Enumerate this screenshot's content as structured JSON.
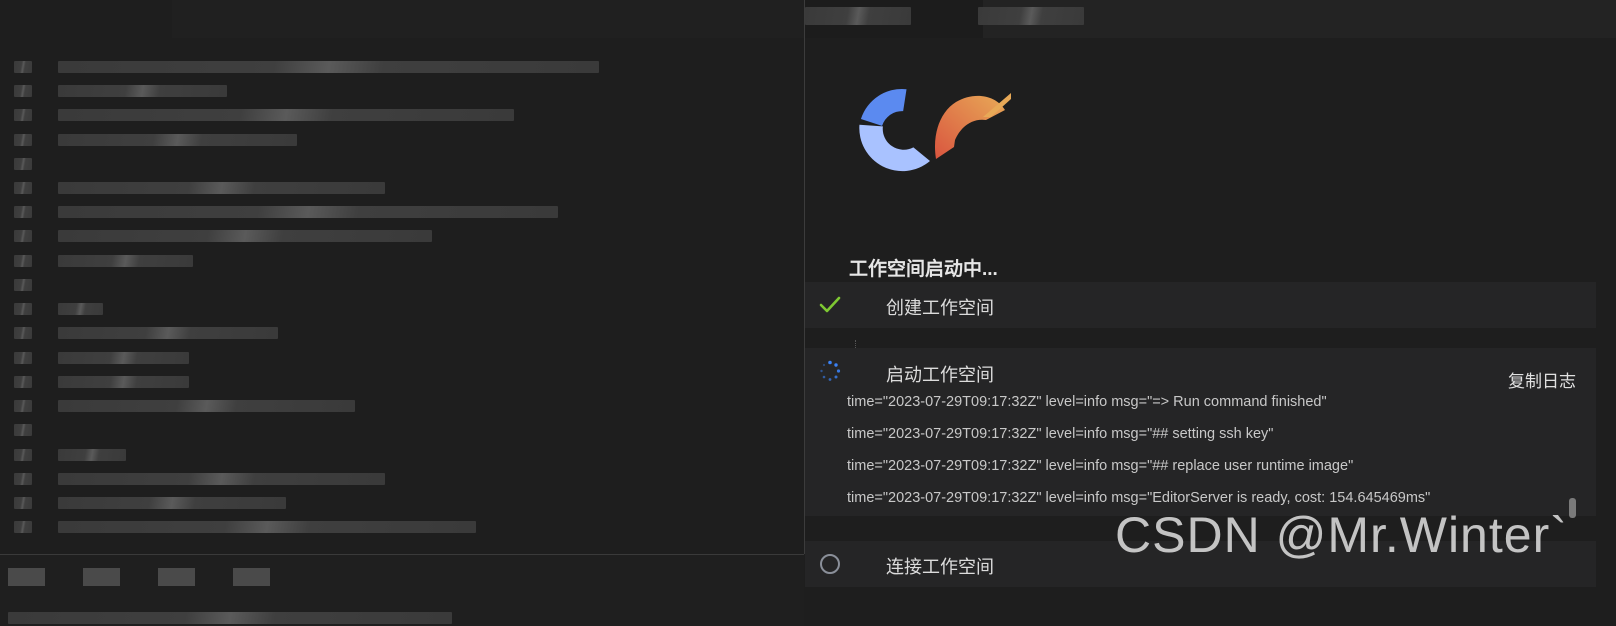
{
  "workspace": {
    "title": "工作空间启动中...",
    "steps": [
      {
        "label": "创建工作空间",
        "status": "done"
      },
      {
        "label": "启动工作空间",
        "status": "loading"
      },
      {
        "label": "连接工作空间",
        "status": "pending"
      }
    ],
    "copy_log_label": "复制日志",
    "logs": [
      "time=\"2023-07-29T09:17:32Z\" level=info msg=\"=> Run command finished\"",
      "time=\"2023-07-29T09:17:32Z\" level=info msg=\"## setting ssh key\"",
      "time=\"2023-07-29T09:17:32Z\" level=info msg=\"## replace user runtime image\"",
      "time=\"2023-07-29T09:17:32Z\" level=info msg=\"EditorServer is ready, cost: 154.645469ms\""
    ]
  },
  "watermark": "CSDN @Mr.Winter`",
  "icons": {
    "logo": "product-logo-icon",
    "done": "check-icon",
    "loading": "spinner-icon",
    "pending": "circle-icon"
  },
  "colors": {
    "check": "#7ec832",
    "spinner": "#3b82f6",
    "pending": "#8a8f99",
    "logo_blue": "#5b8af0",
    "logo_light_blue": "#a9c2ff",
    "logo_orange": "#e0824a"
  }
}
